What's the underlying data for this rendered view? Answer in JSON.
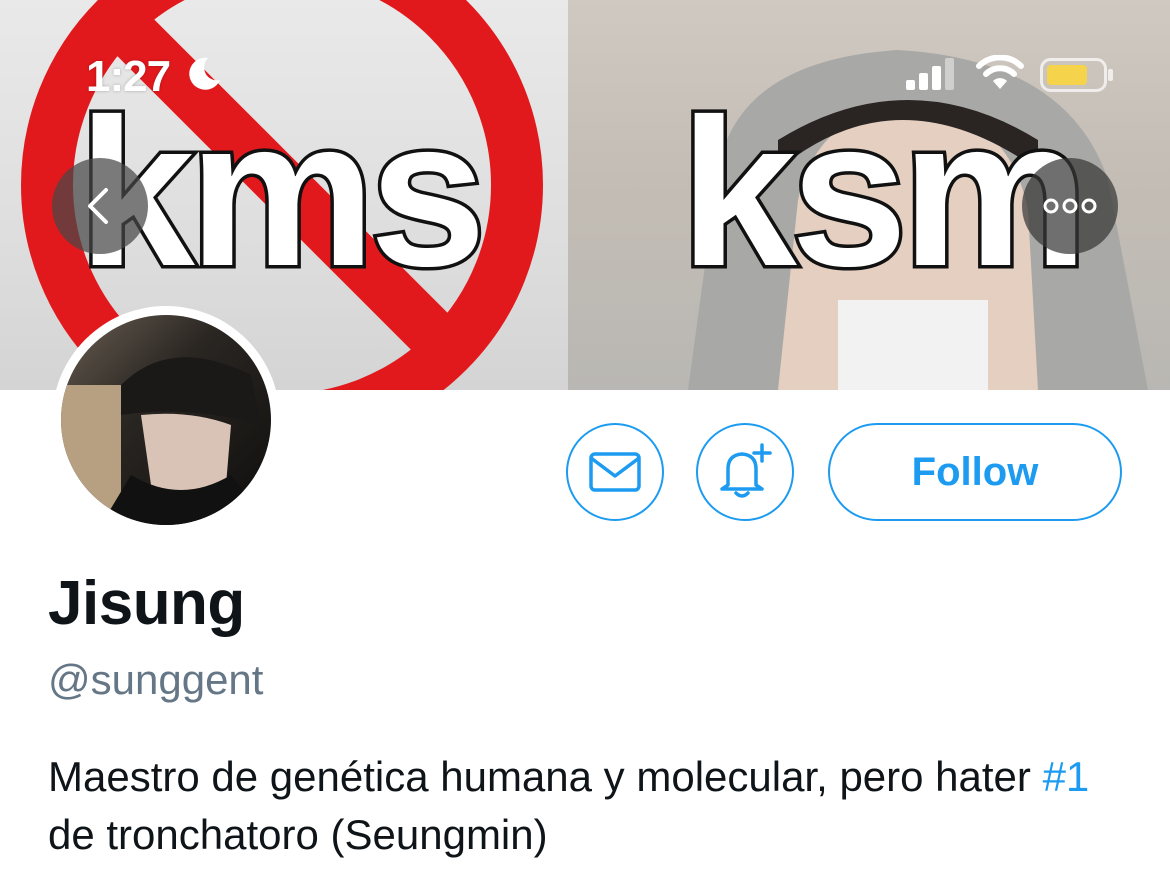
{
  "status_bar": {
    "time": "1:27",
    "battery_color": "#f5d34a"
  },
  "header": {
    "banner_left_text": "kms",
    "banner_right_text": "ksm"
  },
  "icons": {
    "back": "chevron-left-icon",
    "more": "more-icon",
    "mail": "mail-icon",
    "bell": "bell-plus-icon"
  },
  "actions": {
    "follow_label": "Follow"
  },
  "profile": {
    "display_name": "Jisung",
    "handle": "@sunggent",
    "bio_part1": "Maestro de genética humana y molecular, pero hater ",
    "bio_hashtag": "#1",
    "bio_part2": " de tronchatoro (Seungmin)"
  },
  "colors": {
    "accent": "#1d9bf0",
    "secondary_text": "#657786",
    "primary_text": "#0f1419",
    "prohibit_red": "#e2191c"
  }
}
